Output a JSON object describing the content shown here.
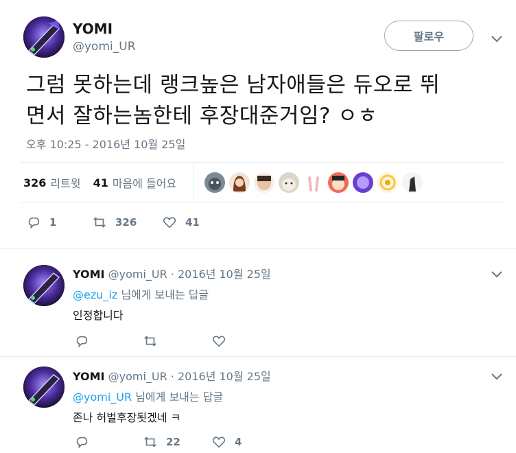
{
  "tweet": {
    "name": "YOMI",
    "handle": "@yomi_UR",
    "follow_label": "팔로우",
    "text_line1": "그럼 못하는데 랭크높은 남자애들은 듀오로 뛰",
    "text_line2": "면서 잘하는놈한테 후장대준거임? ㅇㅎ",
    "timestamp": "오후 10:25 - 2016년 10월 25일",
    "retweet_count": "326",
    "retweet_label": "리트윗",
    "like_count": "41",
    "like_label": "마음에 들어요",
    "action_reply_count": "1",
    "action_retweet_count": "326",
    "action_like_count": "41"
  },
  "replies": [
    {
      "name": "YOMI",
      "handle_date": "@yomi_UR · 2016년 10월 25일",
      "reply_to_user": "@ezu_iz",
      "reply_to_suffix": " 님에게 보내는 답글",
      "text": "인정합니다",
      "reply_count": "",
      "retweet_count": "",
      "like_count": ""
    },
    {
      "name": "YOMI",
      "handle_date": "@yomi_UR · 2016년 10월 25일",
      "reply_to_user": "@yomi_UR",
      "reply_to_suffix": " 님에게 보내는 답글",
      "text": "존나 허벌후장됫겠네 ㅋ",
      "reply_count": "",
      "retweet_count": "22",
      "like_count": "4"
    }
  ],
  "icons": {
    "chevron": "chevron-down-icon",
    "reply": "reply-icon",
    "retweet": "retweet-icon",
    "like": "heart-icon"
  },
  "colors": {
    "text": "#14171a",
    "muted": "#657786",
    "link": "#1da1f2",
    "border": "#e6ecf0"
  }
}
